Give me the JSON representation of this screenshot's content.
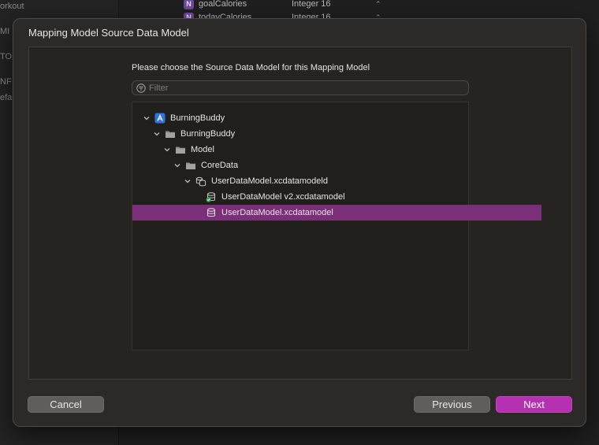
{
  "background": {
    "sidebar_fragments": [
      "orkout",
      "MI",
      "TO",
      "NF",
      "efa"
    ],
    "attributes": [
      {
        "badge": "N",
        "name": "goalCalories",
        "type": "Integer 16"
      },
      {
        "badge": "N",
        "name": "todayCalories",
        "type": "Integer 16"
      }
    ]
  },
  "dialog": {
    "title": "Mapping Model Source Data Model",
    "instruction": "Please choose the Source Data Model for this Mapping Model",
    "filter_placeholder": "Filter",
    "filter_value": "",
    "tree": [
      {
        "label": "BurningBuddy",
        "icon": "xcode-project-icon",
        "level": 0,
        "expanded": true,
        "selected": false
      },
      {
        "label": "BurningBuddy",
        "icon": "folder-icon",
        "level": 1,
        "expanded": true,
        "selected": false
      },
      {
        "label": "Model",
        "icon": "folder-icon",
        "level": 2,
        "expanded": true,
        "selected": false
      },
      {
        "label": "CoreData",
        "icon": "folder-icon",
        "level": 3,
        "expanded": true,
        "selected": false
      },
      {
        "label": "UserDataModel.xcdatamodeld",
        "icon": "versioned-data-model-icon",
        "level": 4,
        "expanded": true,
        "selected": false
      },
      {
        "label": "UserDataModel v2.xcdatamodel",
        "icon": "current-data-model-icon",
        "level": 5,
        "expanded": false,
        "selected": false
      },
      {
        "label": "UserDataModel.xcdatamodel",
        "icon": "data-model-icon",
        "level": 5,
        "expanded": false,
        "selected": true
      }
    ],
    "buttons": {
      "cancel": "Cancel",
      "previous": "Previous",
      "next": "Next"
    },
    "colors": {
      "selection": "#7a2f78",
      "primary_button": "#b531b1"
    }
  }
}
